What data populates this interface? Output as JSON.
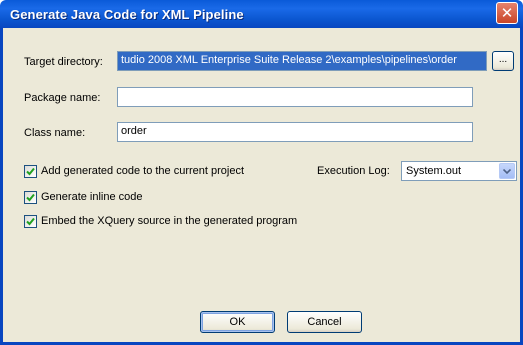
{
  "window": {
    "title": "Generate Java Code for XML Pipeline",
    "close_glyph": "✕"
  },
  "form": {
    "target_directory_label": "Target directory:",
    "target_directory_value": "tudio 2008 XML Enterprise Suite Release 2\\examples\\pipelines\\order",
    "browse_label": "...",
    "package_name_label": "Package name:",
    "package_name_value": "",
    "class_name_label": "Class name:",
    "class_name_value": "order"
  },
  "options": {
    "add_to_project_label": "Add generated code to the current project",
    "add_to_project_checked": true,
    "inline_code_label": "Generate inline code",
    "inline_code_checked": true,
    "embed_xquery_label": "Embed the XQuery source in the generated program",
    "embed_xquery_checked": true,
    "execution_log_label": "Execution Log:",
    "execution_log_value": "System.out"
  },
  "buttons": {
    "ok_label": "OK",
    "cancel_label": "Cancel"
  },
  "colors": {
    "titlebar": "#0a5ad8",
    "dialog_bg": "#ece9d8",
    "selection": "#316ac5",
    "checkmark": "#21a121"
  }
}
